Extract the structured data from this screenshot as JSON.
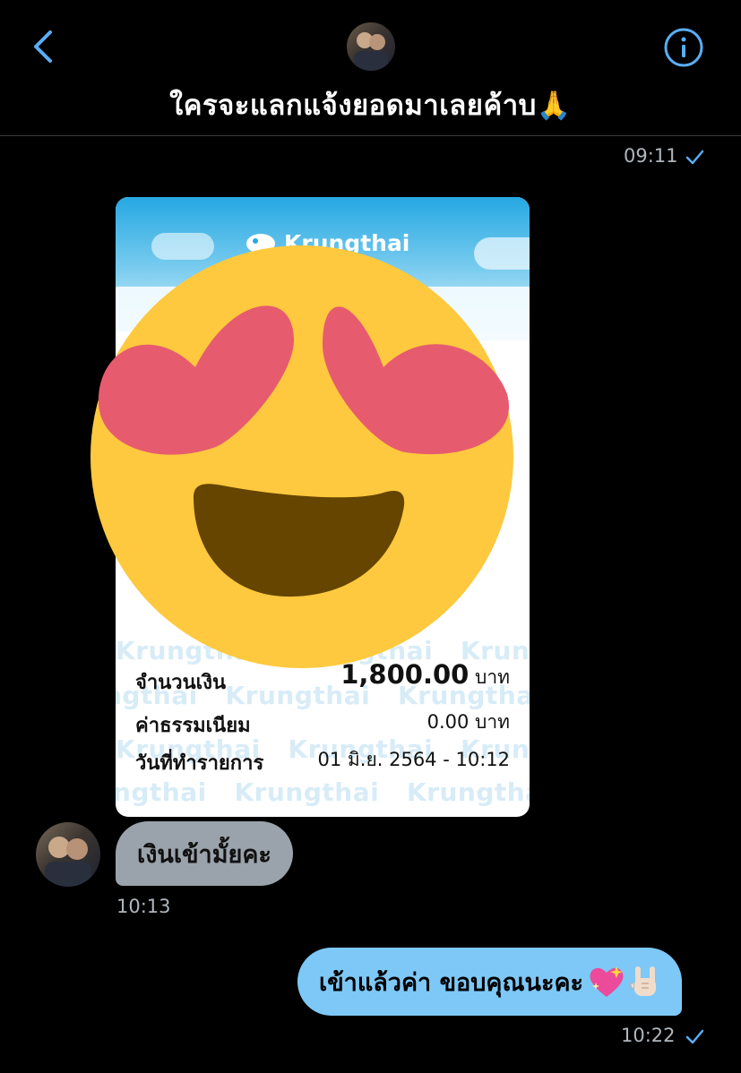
{
  "header": {
    "title": "ใครจะแลกแจ้งยอดมาเลยค้าบ🙏",
    "back_icon": "chevron-left-icon",
    "info_icon": "info-icon",
    "accent": "#5aaef5"
  },
  "messages": {
    "receipt_time": "09:11",
    "receipt": {
      "bank_name": "Krungthai",
      "watermark": "Krungthai",
      "amount_label": "จำนวนเงิน",
      "amount_value": "1,800.00",
      "amount_unit": "บาท",
      "fee_label": "ค่าธรรมเนียม",
      "fee_value": "0.00 บาท",
      "date_label": "วันที่ทำรายการ",
      "date_value": "01 มิ.ย. 2564 - 10:12",
      "overlay_emoji": "heart-eyes-emoji"
    },
    "incoming": {
      "text": "เงินเข้ามั้ยคะ",
      "time": "10:13"
    },
    "outgoing": {
      "text": "เข้าแล้วค่า ขอบคุณนะคะ",
      "emojis": [
        "sparkling-heart-emoji",
        "rock-on-hand-emoji"
      ],
      "time": "10:22"
    }
  },
  "colors": {
    "background": "#000000",
    "incoming_bubble": "#9aa3ab",
    "outgoing_bubble": "#7dc8f7"
  }
}
